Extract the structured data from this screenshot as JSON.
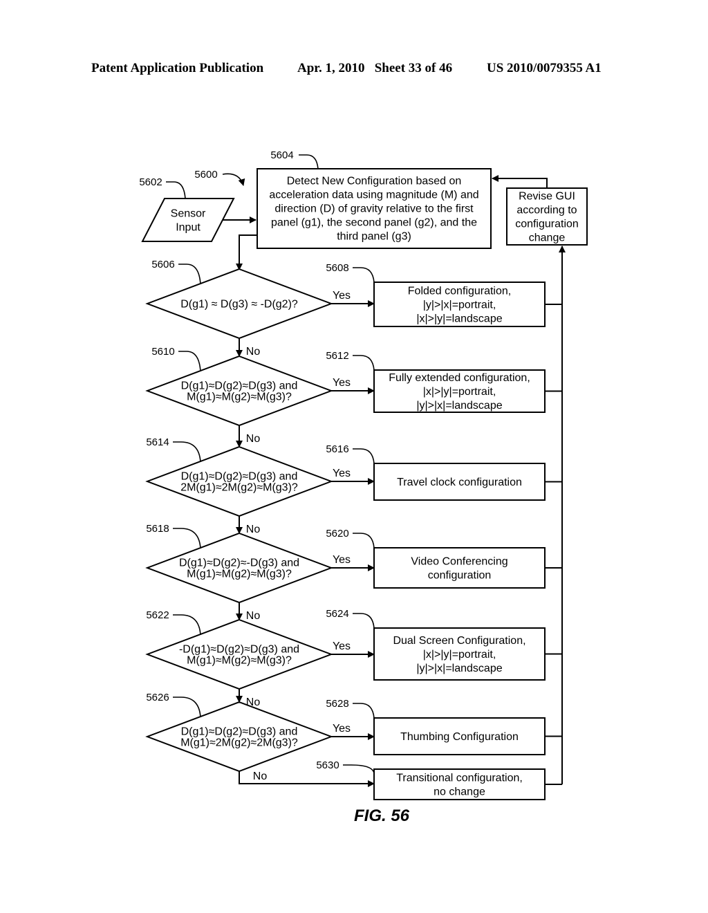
{
  "header": {
    "publication": "Patent Application Publication",
    "date_sheet": "Apr. 1, 2010   Sheet 33 of 46",
    "number": "US 2010/0079355 A1"
  },
  "figure": {
    "label": "FIG. 56",
    "ref": "5600"
  },
  "sensor_input": {
    "ref": "5602",
    "lines": [
      "Sensor",
      "Input"
    ]
  },
  "detect_box": {
    "ref": "5604",
    "lines": [
      "Detect New Configuration based on",
      "acceleration data using magnitude (M) and",
      "direction (D) of gravity relative to the first",
      "panel (g1), the second panel (g2), and the",
      "third panel (g3)"
    ]
  },
  "revise_box": {
    "lines": [
      "Revise GUI",
      "according to",
      "configuration",
      "change"
    ]
  },
  "edge_labels": {
    "yes": "Yes",
    "no": "No"
  },
  "decisions": [
    {
      "ref": "5606",
      "lines": [
        "D(g1) ≈ D(g3) ≈ -D(g2)?"
      ],
      "result": {
        "ref": "5608",
        "lines": [
          "Folded configuration,",
          "|y|>|x|=portrait,",
          "|x|>|y|=landscape"
        ]
      }
    },
    {
      "ref": "5610",
      "lines": [
        "D(g1)≈D(g2)≈D(g3) and",
        "M(g1)≈M(g2)≈M(g3)?"
      ],
      "result": {
        "ref": "5612",
        "lines": [
          "Fully extended configuration,",
          "|x|>|y|=portrait,",
          "|y|>|x|=landscape"
        ]
      }
    },
    {
      "ref": "5614",
      "lines": [
        "D(g1)≈D(g2)≈D(g3) and",
        "2M(g1)≈2M(g2)≈M(g3)?"
      ],
      "result": {
        "ref": "5616",
        "lines": [
          "Travel clock configuration"
        ]
      }
    },
    {
      "ref": "5618",
      "lines": [
        "D(g1)≈D(g2)≈-D(g3) and",
        "M(g1)≈M(g2)≈M(g3)?"
      ],
      "result": {
        "ref": "5620",
        "lines": [
          "Video Conferencing",
          "configuration"
        ]
      }
    },
    {
      "ref": "5622",
      "lines": [
        "-D(g1)≈D(g2)≈D(g3) and",
        "M(g1)≈M(g2)≈M(g3)?"
      ],
      "result": {
        "ref": "5624",
        "lines": [
          "Dual Screen Configuration,",
          "|x|>|y|=portrait,",
          "|y|>|x|=landscape"
        ]
      }
    },
    {
      "ref": "5626",
      "lines": [
        "D(g1)≈D(g2)≈D(g3) and",
        "M(g1)≈2M(g2)≈2M(g3)?"
      ],
      "result": {
        "ref": "5628",
        "lines": [
          "Thumbing Configuration"
        ]
      }
    }
  ],
  "fallback": {
    "ref": "5630",
    "lines": [
      "Transitional configuration,",
      "no change"
    ]
  }
}
